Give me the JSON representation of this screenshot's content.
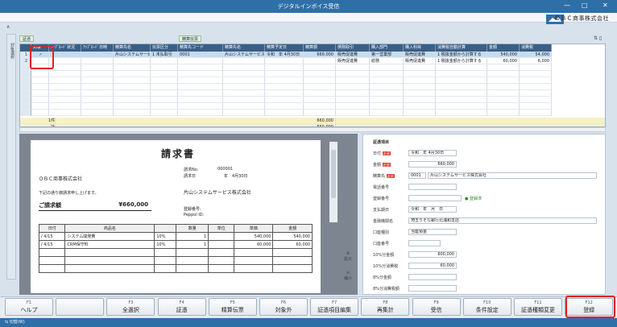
{
  "app": {
    "title": "デジタルインボイス受信",
    "company": "ＯＢＣ商事株式会社"
  },
  "window_controls": {
    "minimize": "—",
    "maximize": "□",
    "close": "✕"
  },
  "tabs": {
    "evidence": "証憑",
    "settlement": "精算伝票"
  },
  "side_tab": "対象選択",
  "grid": {
    "columns": [
      "対象",
      "ｱｯﾌﾟﾛｰﾄﾞ状況",
      "ｱｯﾌﾟﾛｰﾄﾞ日時",
      "精算先名",
      "伝票区分",
      "精算先コード",
      "精算先名",
      "精算予定日",
      "精算額",
      "債務取引",
      "購入部門",
      "購入科目",
      "消費税自動計算",
      "金額",
      "消費税"
    ],
    "rows": [
      {
        "no": "1",
        "check": "✓",
        "status": "",
        "date": "",
        "payee": "片山システムサービス株",
        "kind": "1 未払取引",
        "code": "0001",
        "payee2": "片山システムサービス株",
        "due": "令和　年 4月30日",
        "amount": "660,000",
        "trade": "販売促進費",
        "dept": "第一営業部",
        "account": "販売促進費",
        "tax_calc": "1 税抜金額から計算する",
        "net": "540,000",
        "tax": "54,000"
      },
      {
        "no": "2",
        "check": "",
        "status": "",
        "date": "",
        "payee": "",
        "kind": "",
        "code": "",
        "payee2": "",
        "due": "",
        "amount": "",
        "trade": "販売促進費",
        "dept": "総務",
        "account": "販売促進費",
        "tax_calc": "1 税抜金額から計算する",
        "net": "60,000",
        "tax": "6,000"
      }
    ],
    "sum_count_label": "1件",
    "sum_total_label": "計",
    "sum_count_amount": "660,000",
    "sum_total_amount": "660,000"
  },
  "invoice": {
    "title": "請求書",
    "no_label": "請求No.",
    "no_value": "000001",
    "date_label": "請求日",
    "date_value": "年　4月30日",
    "to": "ＯＢＣ商事株式会社",
    "greeting": "下記の通り御請求申し上げます。",
    "total_label": "ご請求額",
    "total_value": "¥660,000",
    "issuer": "片山システムサービス株式会社",
    "reg_label": "登録番号:",
    "peppol_label": "Peppol ID:",
    "headers": [
      "日付",
      "商品名",
      "",
      "数量",
      "単位",
      "単価",
      "金額"
    ],
    "lines": [
      {
        "date": "/ 4/15",
        "item": "システム開発費",
        "rate": "10%",
        "qty": "1",
        "unit": "",
        "price": "540,000",
        "amt": "540,000"
      },
      {
        "date": "/ 4/15",
        "item": "CRM保守料",
        "rate": "10%",
        "qty": "1",
        "unit": "",
        "price": "60,000",
        "amt": "60,000"
      }
    ],
    "zoom_in": "拡大",
    "zoom_out": "縮小"
  },
  "form": {
    "section": "証憑項目",
    "date_label": "日付",
    "date_value": "令和　年 4月30日",
    "amount_label": "金額",
    "amount_value": "660,000",
    "payee_label": "精算先",
    "payee_code": "0001",
    "payee_name": "片山システムサービス株式会社",
    "phone_label": "電話番号",
    "reg_label": "登録番号",
    "registered": "登録済",
    "pay_date_label": "支払期日",
    "pay_date_value": "令和　年　月　日",
    "bank_label": "金融機関名",
    "bank_value": "埼玉りそな銀行北浦和支店",
    "acct_type_label": "口座種別",
    "acct_type_value": "当座預金",
    "acct_no_label": "口座番号",
    "r10_label": "10%分金額",
    "r10_value": "600,000",
    "r10tax_label": "10%分消費税",
    "r10tax_value": "60,000",
    "r8_label": "8%分金額",
    "r8tax_label": "8%分消費税額",
    "required": "必須"
  },
  "fkeys": [
    {
      "key": "F1",
      "label": "ヘルプ"
    },
    {
      "key": "",
      "label": ""
    },
    {
      "key": "F3",
      "label": "全選択"
    },
    {
      "key": "F4",
      "label": "証憑"
    },
    {
      "key": "F5",
      "label": "精算伝票"
    },
    {
      "key": "F6",
      "label": "対象外"
    },
    {
      "key": "F7",
      "label": "証憑項目編集"
    },
    {
      "key": "F8",
      "label": "再集計"
    },
    {
      "key": "F9",
      "label": "受信"
    },
    {
      "key": "F10",
      "label": "条件設定"
    },
    {
      "key": "F11",
      "label": "証憑種類変更"
    },
    {
      "key": "F12",
      "label": "登録"
    }
  ],
  "status": {
    "switch": "切替(W)"
  }
}
